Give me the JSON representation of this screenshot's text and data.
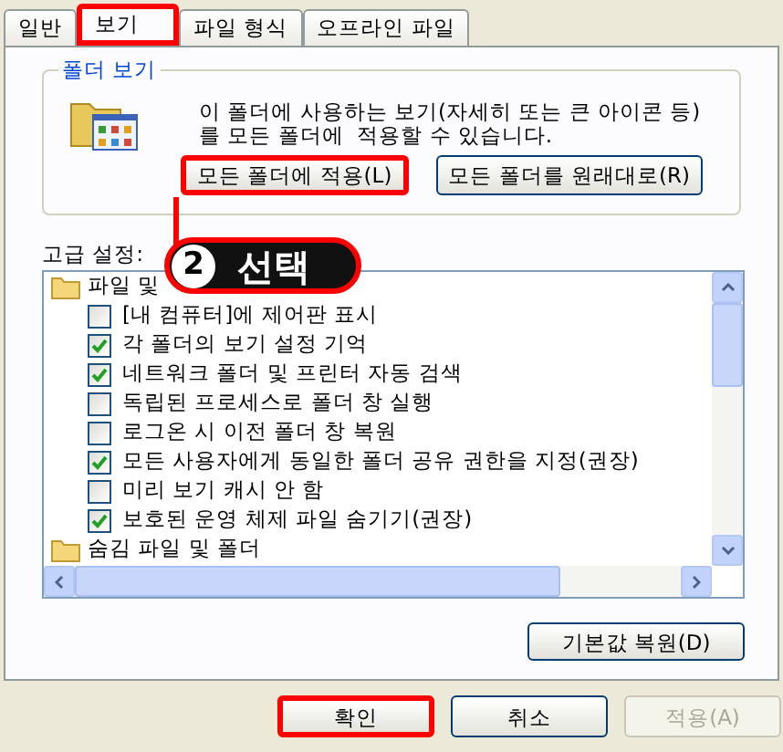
{
  "tabs": [
    {
      "label": "일반",
      "selected": false,
      "highlighted": false
    },
    {
      "label": "보기",
      "selected": true,
      "highlighted": true
    },
    {
      "label": "파일 형식",
      "selected": false,
      "highlighted": false
    },
    {
      "label": "오프라인 파일",
      "selected": false,
      "highlighted": false
    }
  ],
  "folder_views": {
    "title": "폴더 보기",
    "description": "이 폴더에 사용하는 보기(자세히 또는 큰 아이콘 등)\n를 모든 폴더에  적용할 수 있습니다.",
    "buttons": [
      {
        "label": "모든 폴더에 적용(L)",
        "highlighted": true
      },
      {
        "label": "모든 폴더를 원래대로(R)",
        "highlighted": false
      }
    ]
  },
  "callout": {
    "number": "2",
    "label": "선택"
  },
  "advanced": {
    "title": "고급 설정:",
    "items": [
      {
        "kind": "folder",
        "label": "파일 및"
      },
      {
        "kind": "checkbox",
        "label": "[내 컴퓨터]에 제어판 표시",
        "checked": false
      },
      {
        "kind": "checkbox",
        "label": "각 폴더의 보기 설정 기억",
        "checked": true
      },
      {
        "kind": "checkbox",
        "label": "네트워크 폴더 및 프린터 자동 검색",
        "checked": true
      },
      {
        "kind": "checkbox",
        "label": "독립된 프로세스로 폴더 창 실행",
        "checked": false
      },
      {
        "kind": "checkbox",
        "label": "로그온 시 이전 폴더 창 복원",
        "checked": false
      },
      {
        "kind": "checkbox",
        "label": "모든 사용자에게 동일한 폴더 공유 권한을 지정(권장)",
        "checked": true
      },
      {
        "kind": "checkbox",
        "label": "미리 보기 캐시 안 함",
        "checked": false
      },
      {
        "kind": "checkbox",
        "label": "보호된 운영 체제 파일 숨기기(권장)",
        "checked": true
      },
      {
        "kind": "folder",
        "label": "숨김 파일 및 폴더"
      }
    ],
    "restore_button": {
      "label": "기본값 복원(D)"
    }
  },
  "footer_buttons": [
    {
      "label": "확인",
      "highlighted": true,
      "disabled": false
    },
    {
      "label": "취소",
      "highlighted": false,
      "disabled": false
    },
    {
      "label": "적용(A)",
      "highlighted": false,
      "disabled": true
    }
  ]
}
